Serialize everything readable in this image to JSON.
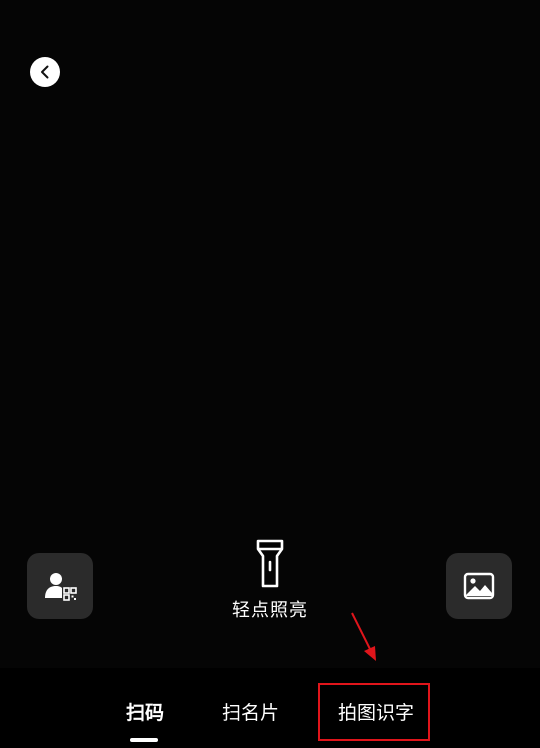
{
  "icons": {
    "back": "chevron-left-icon",
    "my_qr": "user-qr-icon",
    "torch": "flashlight-icon",
    "album": "image-icon"
  },
  "torch": {
    "label": "轻点照亮"
  },
  "tabs": [
    {
      "label": "扫码",
      "active": true
    },
    {
      "label": "扫名片",
      "active": false
    },
    {
      "label": "拍图识字",
      "active": false
    }
  ],
  "colors": {
    "background": "#050505",
    "side_button": "#2b2b2b",
    "highlight": "#e0151b",
    "text": "#ffffff"
  }
}
